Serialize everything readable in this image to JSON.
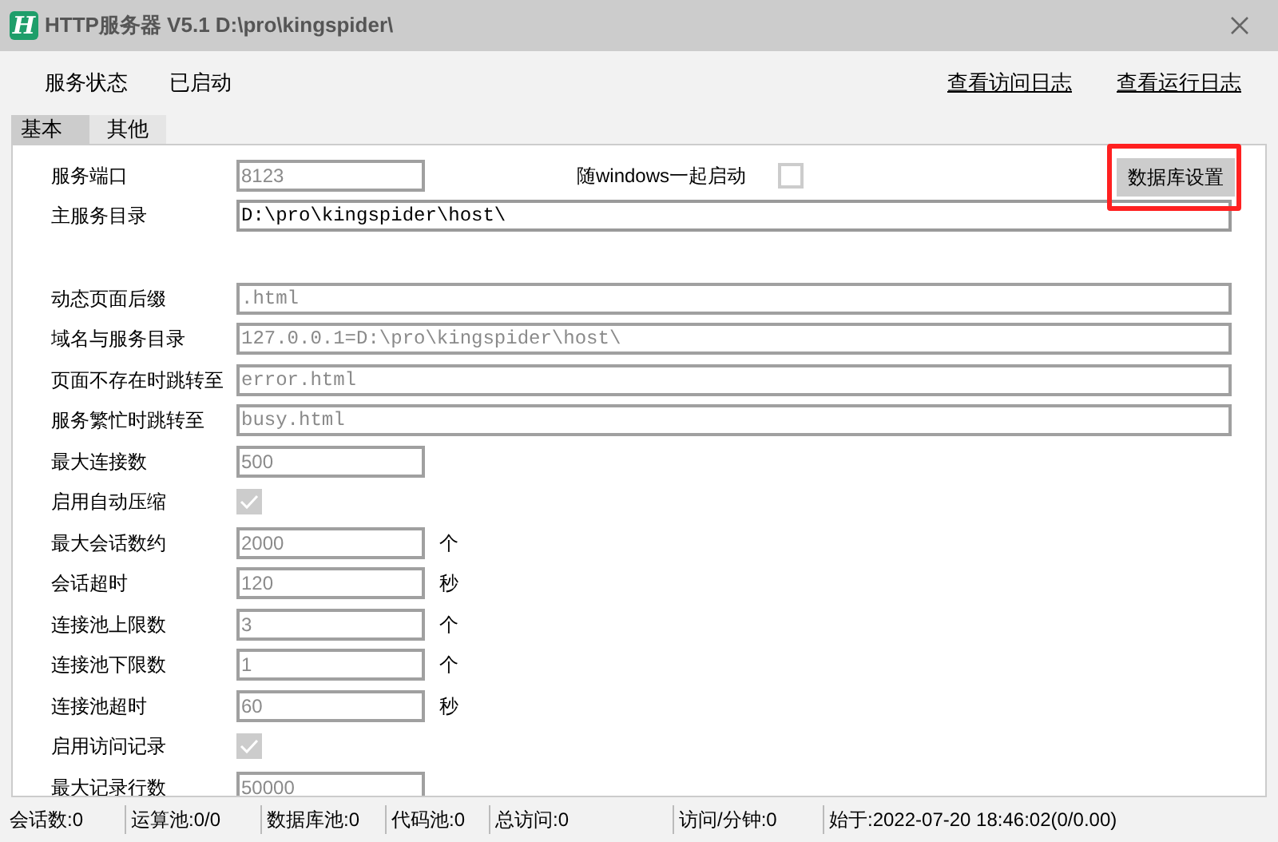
{
  "window": {
    "title": "HTTP服务器 V5.1 D:\\pro\\kingspider\\",
    "icon_letter": "H"
  },
  "header": {
    "status_label": "服务状态",
    "status_value": "已启动",
    "links": [
      "查看访问日志",
      "查看运行日志"
    ]
  },
  "tabs": [
    {
      "label": "基本",
      "selected": true
    },
    {
      "label": "其他",
      "selected": false
    }
  ],
  "port_row": {
    "label": "服务端口",
    "value": "8123",
    "disabled": true,
    "autostart_label": "随windows一起启动",
    "autostart_checked": false,
    "db_button": "数据库设置",
    "db_button_highlighted": true
  },
  "sections": [
    [
      {
        "kind": "long",
        "label": "主服务目录",
        "value": "D:\\pro\\kingspider\\host\\",
        "disabled": false
      }
    ],
    [
      {
        "kind": "long",
        "label": "动态页面后缀",
        "value": ".html",
        "disabled": true
      },
      {
        "kind": "long",
        "label": "域名与服务目录",
        "value": "127.0.0.1=D:\\pro\\kingspider\\host\\",
        "disabled": true
      },
      {
        "kind": "long",
        "label": "页面不存在时跳转至",
        "value": "error.html",
        "disabled": true
      },
      {
        "kind": "long",
        "label": "服务繁忙时跳转至",
        "value": "busy.html",
        "disabled": true
      },
      {
        "kind": "short",
        "label": "最大连接数",
        "value": "500",
        "disabled": true
      },
      {
        "kind": "check",
        "label": "启用自动压缩",
        "checked": true,
        "disabled": true
      },
      {
        "kind": "short",
        "label": "最大会话数约",
        "value": "2000",
        "unit": "个",
        "disabled": true
      },
      {
        "kind": "short",
        "label": "会话超时",
        "value": "120",
        "unit": "秒",
        "disabled": true
      },
      {
        "kind": "short",
        "label": "连接池上限数",
        "value": "3",
        "unit": "个",
        "disabled": true
      },
      {
        "kind": "short",
        "label": "连接池下限数",
        "value": "1",
        "unit": "个",
        "disabled": true
      },
      {
        "kind": "short",
        "label": "连接池超时",
        "value": "60",
        "unit": "秒",
        "disabled": true
      },
      {
        "kind": "check",
        "label": "启用访问记录",
        "checked": true,
        "disabled": true
      },
      {
        "kind": "short",
        "label": "最大记录行数",
        "value": "50000",
        "disabled": true
      }
    ]
  ],
  "status_bar": [
    "会话数:0",
    "运算池:0/0",
    "数据库池:0",
    "代码池:0",
    "总访问:0",
    "访问/分钟:0",
    "始于:2022-07-20 18:46:02(0/0.00)"
  ]
}
